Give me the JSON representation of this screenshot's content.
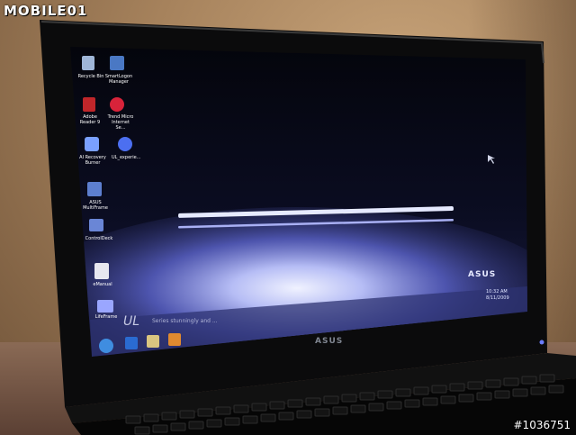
{
  "watermark": {
    "logo": "MOBILE01",
    "photo_id": "#1036751"
  },
  "desktop": {
    "icons": [
      {
        "label": "Recycle Bin",
        "icon": "recycle-bin-icon"
      },
      {
        "label": "SmartLogon Manager",
        "icon": "smartlogon-icon"
      },
      {
        "label": "Adobe Reader 9",
        "icon": "adobe-reader-icon"
      },
      {
        "label": "Trend Micro Internet Se...",
        "icon": "trend-micro-icon"
      },
      {
        "label": "AI Recovery Burner",
        "icon": "ai-recovery-icon"
      },
      {
        "label": "UL_experie...",
        "icon": "ul-experience-icon"
      },
      {
        "label": "ASUS MultiFrame",
        "icon": "multiframe-icon"
      },
      {
        "label": "ControlDeck",
        "icon": "controldeck-icon"
      },
      {
        "label": "eManual",
        "icon": "emanual-icon"
      },
      {
        "label": "LifeFrame",
        "icon": "lifeframe-icon"
      }
    ],
    "wallpaper_brand": "ASUS",
    "wallpaper_series": "UL",
    "wallpaper_tagline": "Series   stunningly and ..."
  },
  "taskbar": {
    "buttons": [
      "start-orb",
      "ie-icon",
      "folder-icon",
      "media-icon"
    ],
    "tray_time": "10:32 AM",
    "tray_date": "8/11/2009"
  },
  "bezel": {
    "logo": "ASUS"
  },
  "colors": {
    "screen_glow": "#a7b0f0",
    "body": "#0a0a0a"
  }
}
